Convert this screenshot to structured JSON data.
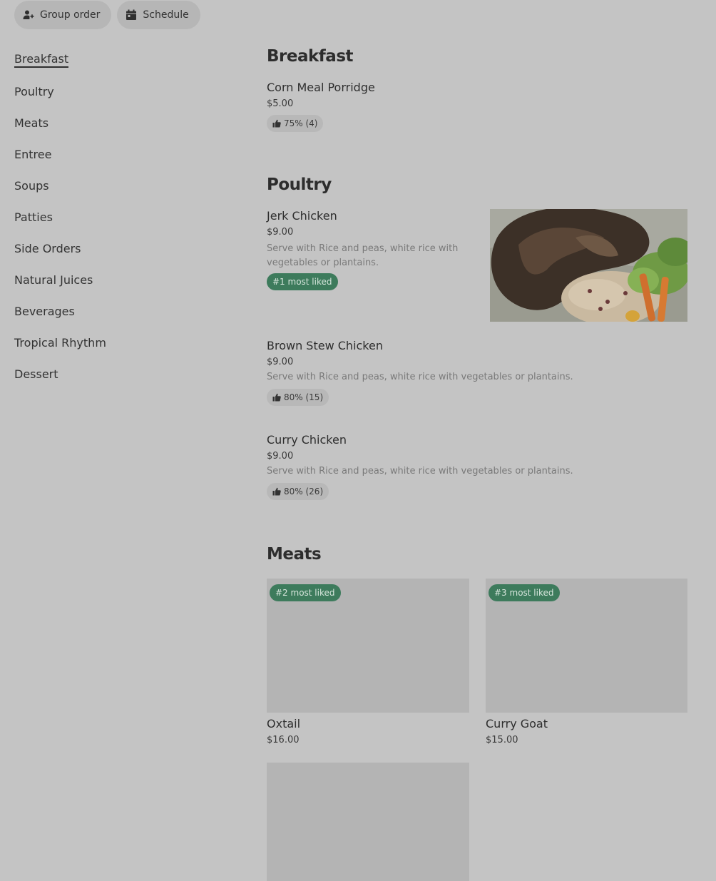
{
  "header": {
    "group_order_label": "Group order",
    "schedule_label": "Schedule"
  },
  "sidebar": {
    "items": [
      {
        "label": "Breakfast",
        "active": true
      },
      {
        "label": "Poultry"
      },
      {
        "label": "Meats"
      },
      {
        "label": "Entree"
      },
      {
        "label": "Soups"
      },
      {
        "label": "Patties"
      },
      {
        "label": "Side Orders"
      },
      {
        "label": "Natural Juices"
      },
      {
        "label": "Beverages"
      },
      {
        "label": "Tropical Rhythm"
      },
      {
        "label": "Dessert"
      }
    ]
  },
  "sections": {
    "breakfast": {
      "title": "Breakfast",
      "items": [
        {
          "name": "Corn Meal Porridge",
          "price": "$5.00",
          "rating": "75% (4)"
        }
      ]
    },
    "poultry": {
      "title": "Poultry",
      "items": [
        {
          "name": "Jerk Chicken",
          "price": "$9.00",
          "description": "Serve with Rice and peas, white rice with vegetables or plantains.",
          "badge": "#1 most liked"
        },
        {
          "name": "Brown Stew Chicken",
          "price": "$9.00",
          "description": "Serve with Rice and peas, white rice with vegetables or plantains.",
          "rating": "80% (15)"
        },
        {
          "name": "Curry Chicken",
          "price": "$9.00",
          "description": "Serve with Rice and peas, white rice with vegetables or plantains.",
          "rating": "80% (26)"
        }
      ]
    },
    "meats": {
      "title": "Meats",
      "items": [
        {
          "name": "Oxtail",
          "price": "$16.00",
          "badge": "#2 most liked"
        },
        {
          "name": "Curry Goat",
          "price": "$15.00",
          "badge": "#3 most liked"
        }
      ]
    }
  },
  "icons": {
    "group_order": "person-plus-icon",
    "schedule": "calendar-icon",
    "rating": "thumbs-up-icon"
  },
  "colors": {
    "background": "#c4c4c4",
    "badge": "#3d7b5c"
  }
}
